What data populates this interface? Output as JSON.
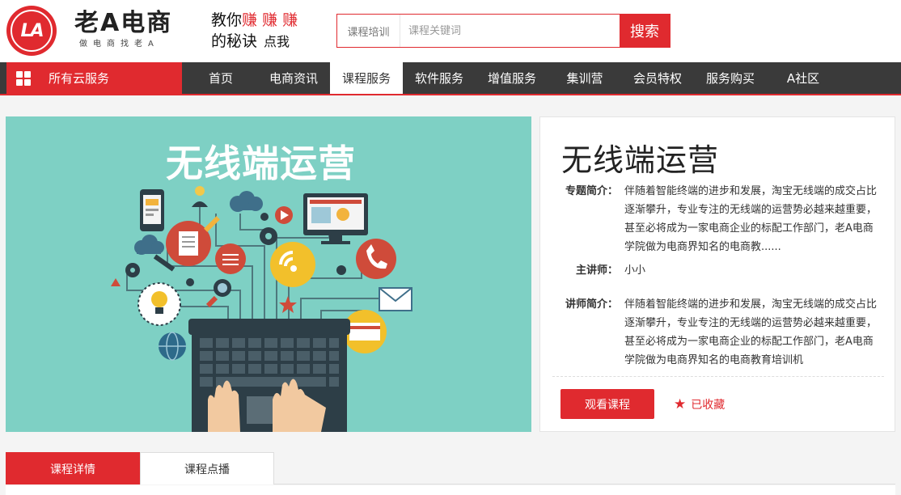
{
  "header": {
    "logo_text": "LA",
    "brand_name": "老A电商",
    "brand_sub": "做电商找老A",
    "slogan_line1_prefix": "教你",
    "slogan_line1_red": "赚 赚 赚",
    "slogan_line2": "的秘诀",
    "slogan_line2_small": "点我",
    "search": {
      "category": "课程培训",
      "placeholder": "课程关键词",
      "button": "搜索"
    }
  },
  "nav": {
    "all_services": "所有云服务",
    "items": [
      "首页",
      "电商资讯",
      "课程服务",
      "软件服务",
      "增值服务",
      "集训营",
      "会员特权",
      "服务购买",
      "A社区"
    ],
    "active_index": 2
  },
  "banner": {
    "title": "无线端运营"
  },
  "course": {
    "title": "无线端运营",
    "intro_label": "专题简介：",
    "intro_text": "伴随着智能终端的进步和发展，淘宝无线端的成交占比逐渐攀升，专业专注的无线端的运营势必越来越重要，甚至必将成为一家电商企业的标配工作部门，老A电商学院做为电商界知名的电商教......",
    "lecturer_label": "主讲师：",
    "lecturer": "小小",
    "lecturer_intro_label": "讲师简介：",
    "lecturer_intro_text": "伴随着智能终端的进步和发展，淘宝无线端的成交占比逐渐攀升，专业专注的无线端的运营势必越来越重要，甚至必将成为一家电商企业的标配工作部门，老A电商学院做为电商界知名的电商教育培训机",
    "watch_button": "观看课程",
    "favorite_label": "已收藏"
  },
  "tabs": {
    "items": [
      "课程详情",
      "课程点播"
    ],
    "active_index": 0
  },
  "colors": {
    "accent": "#e02a2f",
    "nav_bg": "#3a3a3a",
    "banner_bg": "#7ed0c4"
  }
}
